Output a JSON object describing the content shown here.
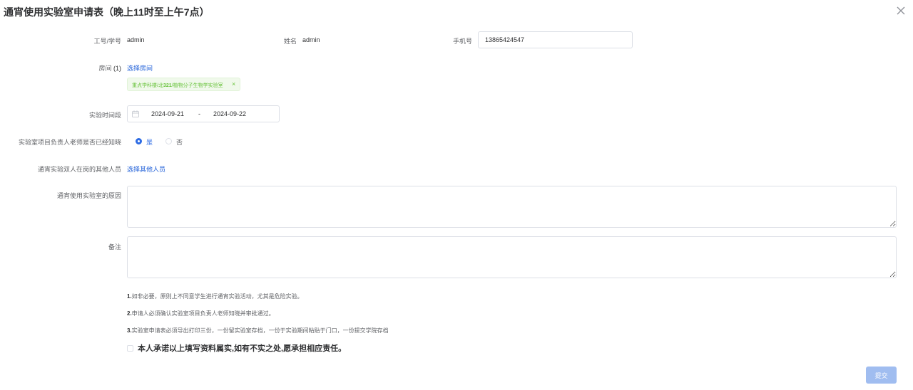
{
  "dialog": {
    "title": "通宵使用实验室申请表（晚上11时至上午7点）"
  },
  "form": {
    "id_label": "工号/学号",
    "id_value": "admin",
    "name_label": "姓名",
    "name_value": "admin",
    "phone_label": "手机号",
    "phone_value": "13865424547",
    "room_label": "房间",
    "room_count": "(1)",
    "room_select_link": "选择房间",
    "room_tag": {
      "prefix": "重点学科楼/北",
      "number": "321",
      "suffix": "/植物分子生物学实验室",
      "close": "×"
    },
    "period_label": "实验时间段",
    "start_date": "2024-09-21",
    "date_separator": "-",
    "end_date": "2024-09-22",
    "aware_label": "实验室项目负责人老师是否已经知晓",
    "aware_yes": "是",
    "aware_no": "否",
    "aware_selected": "是",
    "others_label": "通宵实验双人在岗的其他人员",
    "others_link": "选择其他人员",
    "reason_label": "通宵使用实验室的原因",
    "reason_value": "",
    "remark_label": "备注",
    "remark_value": ""
  },
  "notes": [
    {
      "num": "1.",
      "text": "如非必要，原则上不同意学生进行通宵实验活动，尤其是危险实验。"
    },
    {
      "num": "2.",
      "text": "申请人必须确认实验室项目负责人老师知晓并审批通过。"
    },
    {
      "num": "3.",
      "text": "实验室申请表必须导出打印三份，一份留实验室存档，一份于实验期间粘贴于门口，一份提交学院存档"
    }
  ],
  "agreement": {
    "text": "本人承诺以上填写资料属实,如有不实之处,愿承担相应责任。",
    "checked": false
  },
  "actions": {
    "submit_label": "提交"
  },
  "colors": {
    "primary": "#2d6be4",
    "link": "#1f5fd8",
    "submit_disabled": "#a0bdf0",
    "tag_text": "#67c23a",
    "tag_bg": "#f0f9eb"
  },
  "icons": {
    "close": "close-icon",
    "calendar": "calendar-icon"
  }
}
